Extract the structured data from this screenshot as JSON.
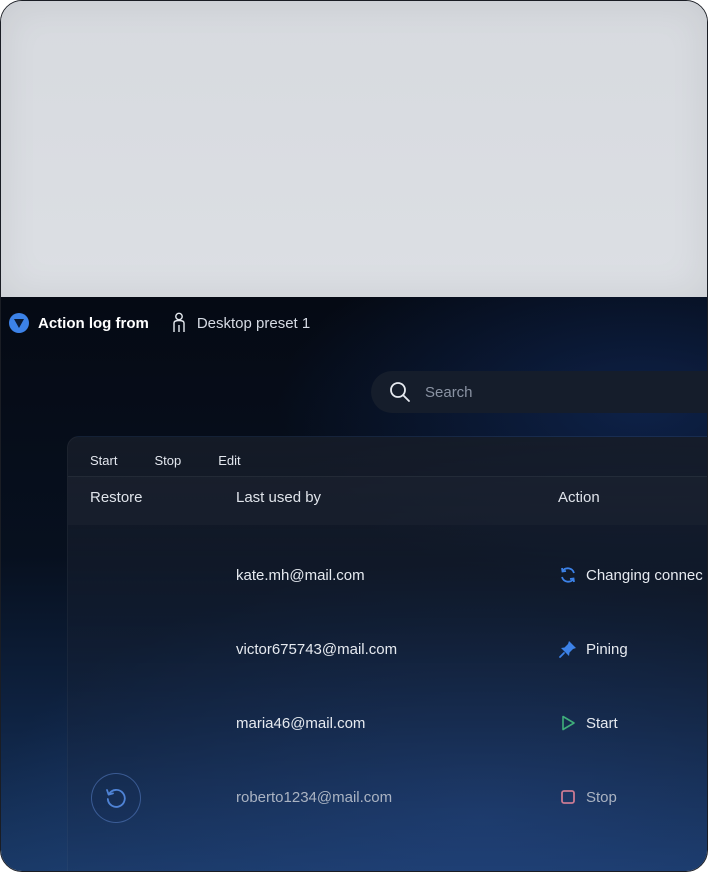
{
  "header": {
    "title": "Action log from",
    "preset": "Desktop preset 1"
  },
  "search": {
    "placeholder": "Search",
    "value": ""
  },
  "toolbar": {
    "items": [
      "Start",
      "Stop",
      "Edit"
    ]
  },
  "table": {
    "columns": [
      "Restore",
      "Last used by",
      "Action"
    ],
    "rows": [
      {
        "email": "kate.mh@mail.com",
        "action": "Changing connec",
        "icon": "refresh-icon"
      },
      {
        "email": "victor675743@mail.com",
        "action": "Pining",
        "icon": "pin-icon"
      },
      {
        "email": "maria46@mail.com",
        "action": "Start",
        "icon": "play-icon"
      },
      {
        "email": "roberto1234@mail.com",
        "action": "Stop",
        "icon": "stop-icon",
        "restore": true
      }
    ]
  },
  "colors": {
    "accent": "#3c82e8",
    "play": "#3fae7a",
    "stop": "#c97a93"
  }
}
